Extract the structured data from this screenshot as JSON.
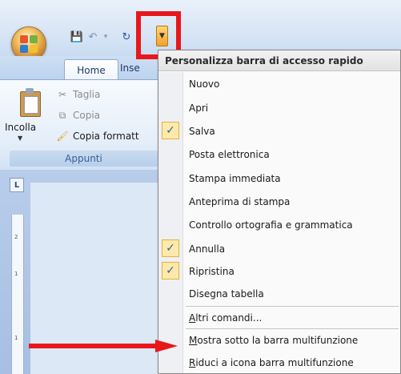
{
  "tabs": {
    "home": "Home",
    "insert_partial": "Inse"
  },
  "clipboard": {
    "paste": "Incolla",
    "cut": "Taglia",
    "copy": "Copia",
    "format_painter": "Copia formatt",
    "group_label": "Appunti"
  },
  "ruler": {
    "corner": "L",
    "mark_2": "2",
    "mark_1": "1",
    "mark_1b": "1"
  },
  "menu": {
    "title": "Personalizza barra di accesso rapido",
    "items": [
      {
        "label": "Nuovo",
        "checked": false
      },
      {
        "label": "Apri",
        "checked": false
      },
      {
        "label": "Salva",
        "checked": true
      },
      {
        "label": "Posta elettronica",
        "checked": false
      },
      {
        "label": "Stampa immediata",
        "checked": false
      },
      {
        "label": "Anteprima di stampa",
        "checked": false
      },
      {
        "label": "Controllo ortografia e grammatica",
        "checked": false
      },
      {
        "label": "Annulla",
        "checked": true
      },
      {
        "label": "Ripristina",
        "checked": true
      },
      {
        "label": "Disegna tabella",
        "checked": false
      }
    ],
    "more_commands": {
      "hotkey": "A",
      "rest": "ltri comandi..."
    },
    "show_below": {
      "hotkey": "M",
      "rest": "ostra sotto la barra multifunzione"
    },
    "minimize": {
      "hotkey": "R",
      "rest": "iduci a icona barra multifunzione"
    }
  },
  "colors": {
    "highlight": "#e8171b",
    "check_bg": "#ffe9a8"
  },
  "icons": {
    "office": "office-button-icon",
    "save": "save-icon",
    "undo": "undo-icon",
    "redo": "redo-icon",
    "qat_dropdown": "chevron-down-icon",
    "cut": "scissors-icon",
    "copy": "copy-icon",
    "format_painter": "brush-icon",
    "check": "check-icon"
  }
}
